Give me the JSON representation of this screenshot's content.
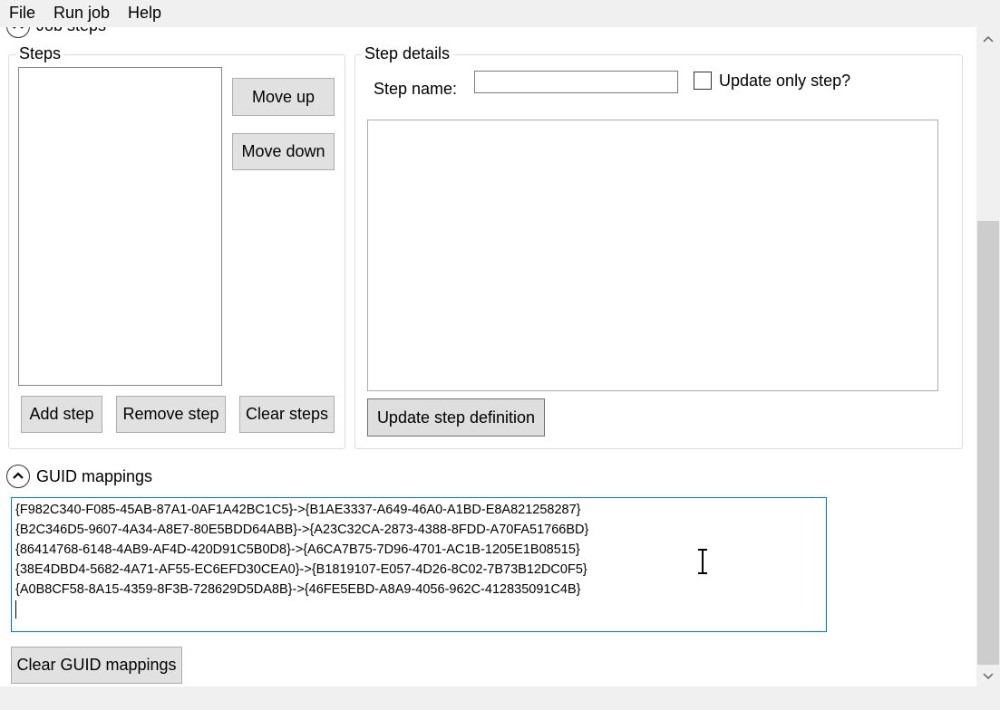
{
  "menu": {
    "file": "File",
    "run_job": "Run job",
    "help": "Help"
  },
  "sections": {
    "job_steps_label": "Job steps",
    "guid_mappings_label": "GUID mappings"
  },
  "steps_group": {
    "title": "Steps",
    "move_up": "Move up",
    "move_down": "Move down",
    "add_step": "Add step",
    "remove_step": "Remove step",
    "clear_steps": "Clear steps"
  },
  "step_details": {
    "title": "Step details",
    "step_name_label": "Step name:",
    "step_name_value": "",
    "update_only_step_label": "Update only step?",
    "update_only_step_checked": false,
    "update_button": "Update step definition"
  },
  "guid_mappings": {
    "lines": [
      "{F982C340-F085-45AB-87A1-0AF1A42BC1C5}->{B1AE3337-A649-46A0-A1BD-E8A821258287}",
      "{B2C346D5-9607-4A34-A8E7-80E5BDD64ABB}->{A23C32CA-2873-4388-8FDD-A70FA51766BD}",
      "{86414768-6148-4AB9-AF4D-420D91C5B0D8}->{A6CA7B75-7D96-4701-AC1B-1205E1B08515}",
      "{38E4DBD4-5682-4A71-AF55-EC6EFD30CEA0}->{B1819107-E057-4D26-8C02-7B73B12DC0F5}",
      "{A0B8CF58-8A15-4359-8F3B-728629D5DA8B}->{46FE5EBD-A8A9-4056-962C-412835091C4B}"
    ],
    "clear_button": "Clear GUID mappings"
  },
  "icons": {
    "expander": "chevron-up-icon",
    "scroll_up": "scroll-up-arrow-icon",
    "scroll_down": "scroll-down-arrow-icon",
    "cursor": "text-ibeam-cursor-icon"
  },
  "colors": {
    "focus_border": "#0078d7",
    "button_bg": "#e1e1e1",
    "window_bg": "#f0f0f0"
  }
}
